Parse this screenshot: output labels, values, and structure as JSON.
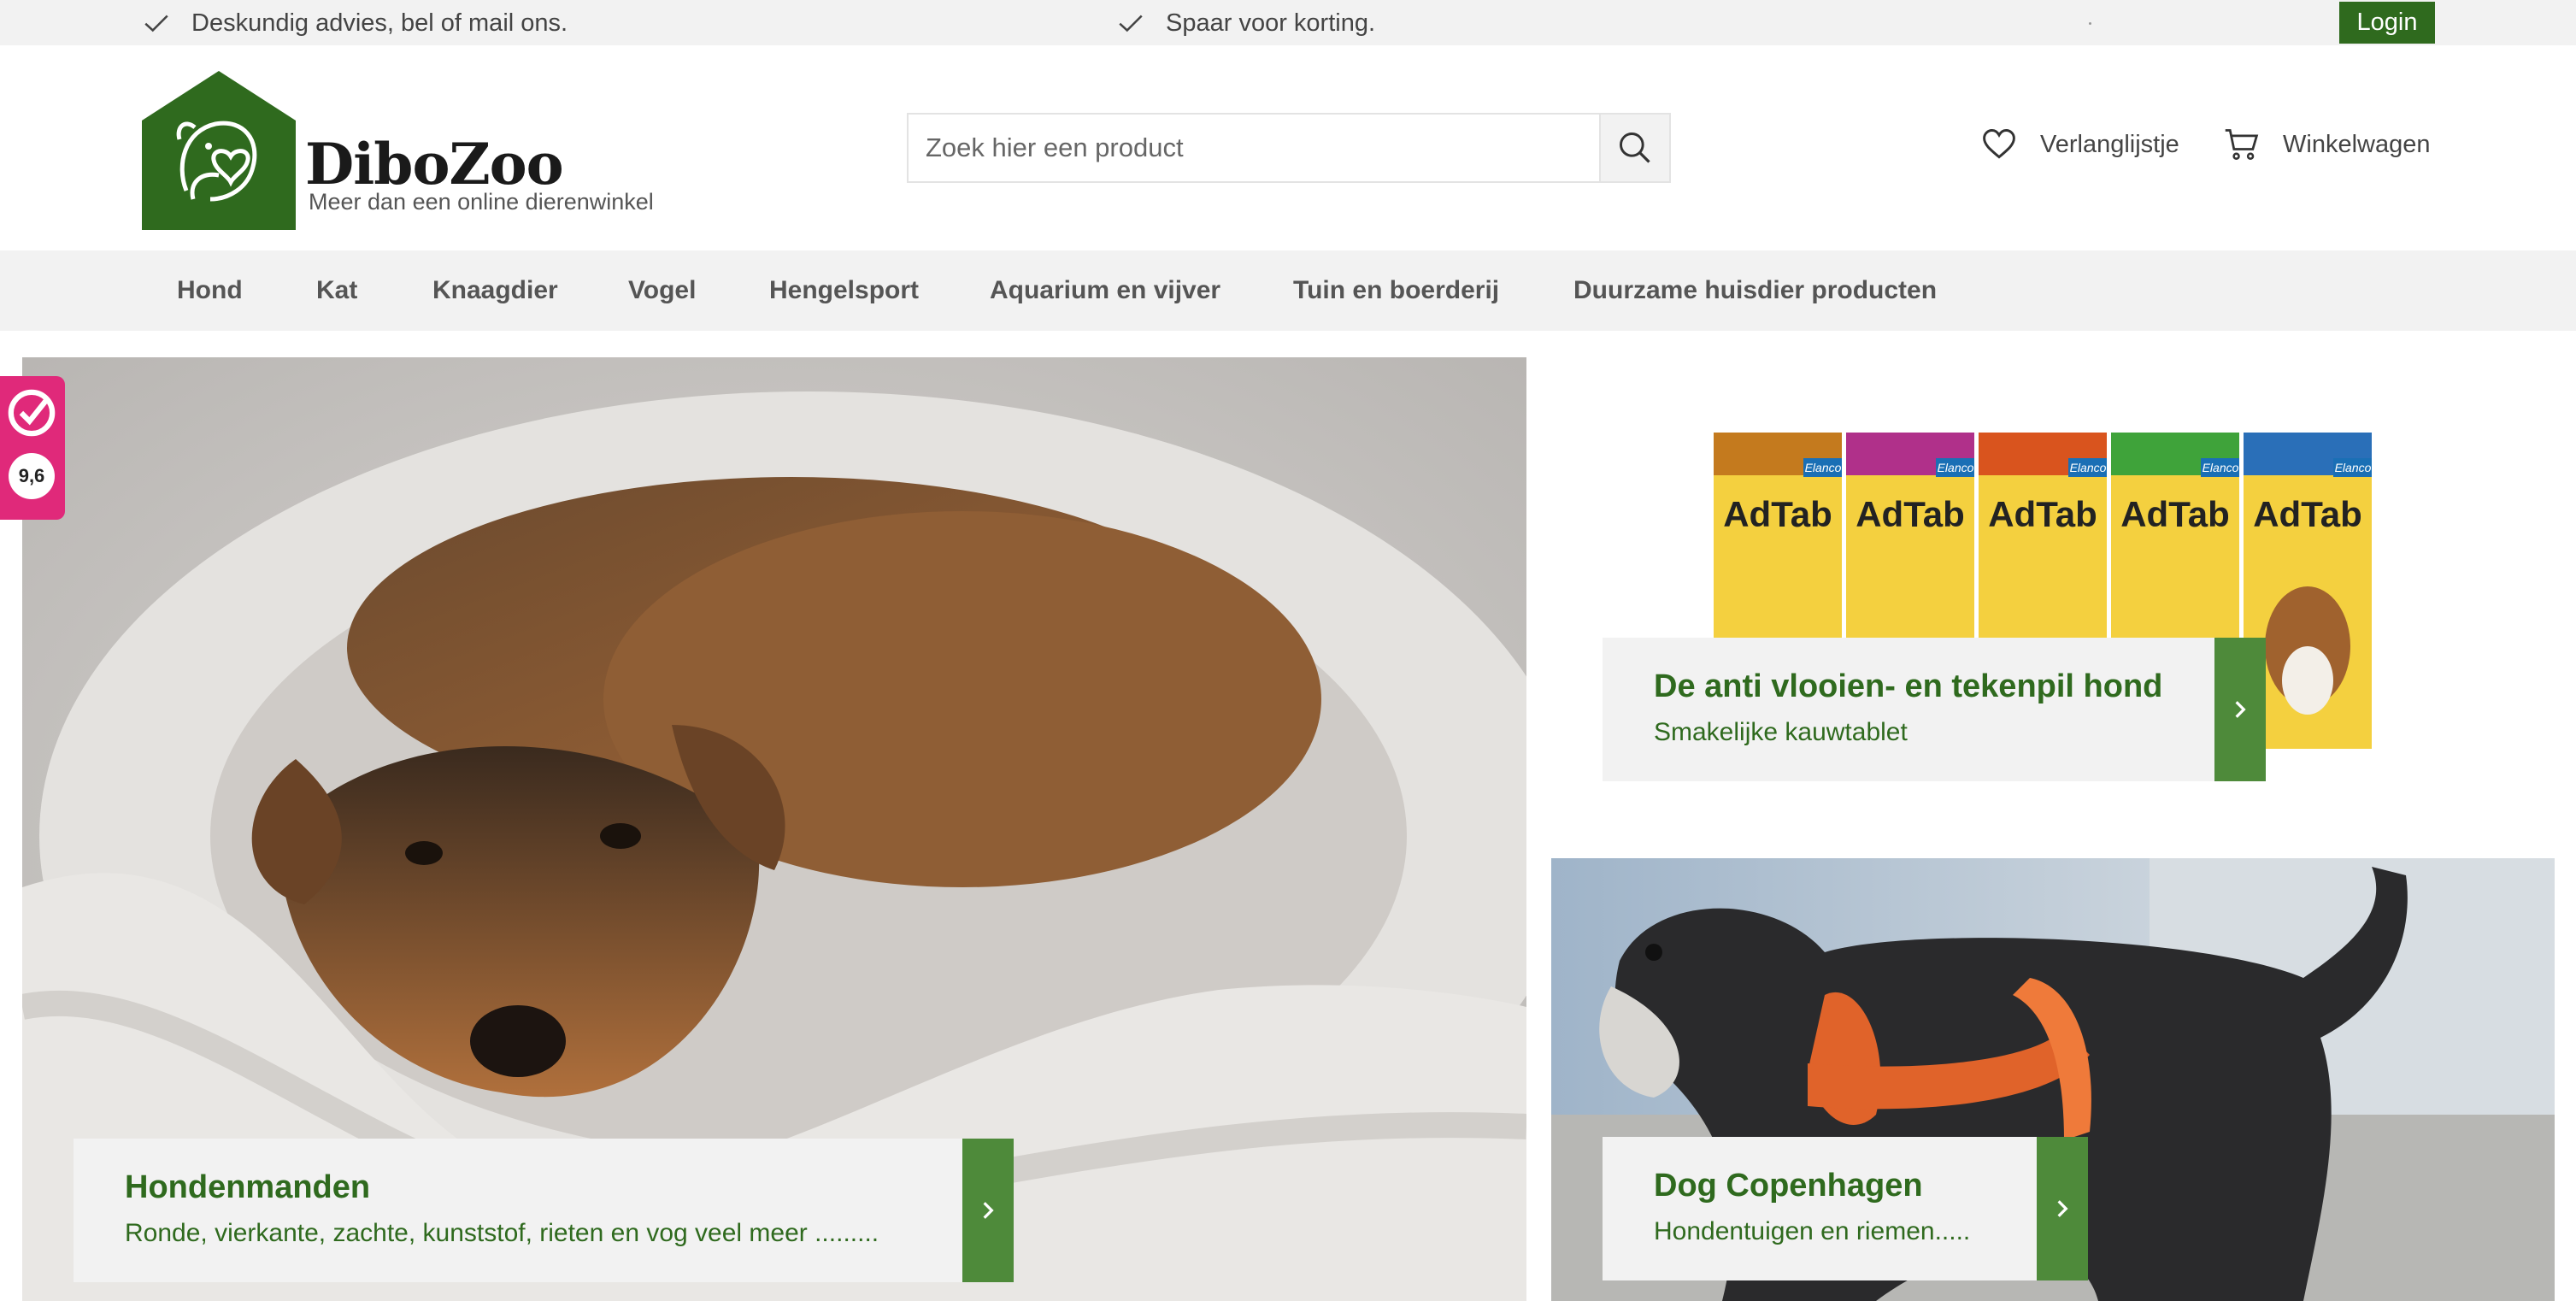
{
  "topbar": {
    "usp1": "Deskundig advies, bel of mail ons.",
    "usp2": "Spaar voor korting.",
    "login": "Login"
  },
  "header": {
    "brand": "DiboZoo",
    "tagline": "Meer dan een online dierenwinkel",
    "search_placeholder": "Zoek hier een product",
    "wishlist": "Verlanglijstje",
    "cart": "Winkelwagen"
  },
  "nav": [
    {
      "label": "Hond"
    },
    {
      "label": "Kat"
    },
    {
      "label": "Knaagdier"
    },
    {
      "label": "Vogel"
    },
    {
      "label": "Hengelsport"
    },
    {
      "label": "Aquarium en vijver"
    },
    {
      "label": "Tuin en boerderij"
    },
    {
      "label": "Duurzame huisdier producten"
    }
  ],
  "banners": {
    "left": {
      "title": "Hondenmanden",
      "subtitle": "Ronde, vierkante, zachte, kunststof, rieten en vog veel meer ........."
    },
    "right_top": {
      "title": "De anti vlooien- en tekenpil hond",
      "subtitle": "Smakelijke kauwtablet",
      "product_label": "AdTab",
      "brand_label": "Elanco"
    },
    "right_bottom": {
      "title": "Dog Copenhagen",
      "subtitle": "Hondentuigen en riemen....."
    }
  },
  "review": {
    "score": "9,6"
  },
  "colors": {
    "brand_green": "#2f6a1e",
    "arrow_green": "#4e8a3a",
    "review_pink": "#e0297a",
    "bar_gray": "#f2f2f2"
  }
}
